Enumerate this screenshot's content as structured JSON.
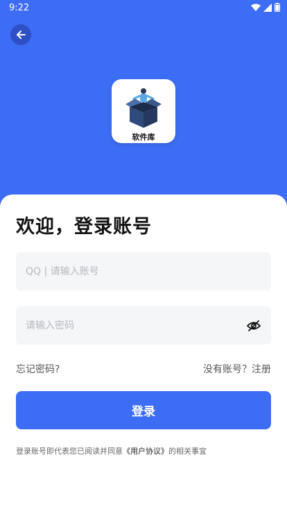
{
  "status_bar": {
    "time": "9:22"
  },
  "header": {
    "app_name": "软件库"
  },
  "login": {
    "title": "欢迎，登录账号",
    "account_placeholder": "QQ | 请输入账号",
    "password_placeholder": "请输入密码",
    "forgot_password": "忘记密码?",
    "register_prompt": "没有账号？注册",
    "submit_label": "登录",
    "agreement_prefix": "登录账号即代表您已阅读并同意",
    "agreement_link": "《用户协议》",
    "agreement_suffix": "的相关事宜"
  },
  "colors": {
    "brand_blue": "#3d6df5",
    "field_bg": "#f5f6f8"
  }
}
